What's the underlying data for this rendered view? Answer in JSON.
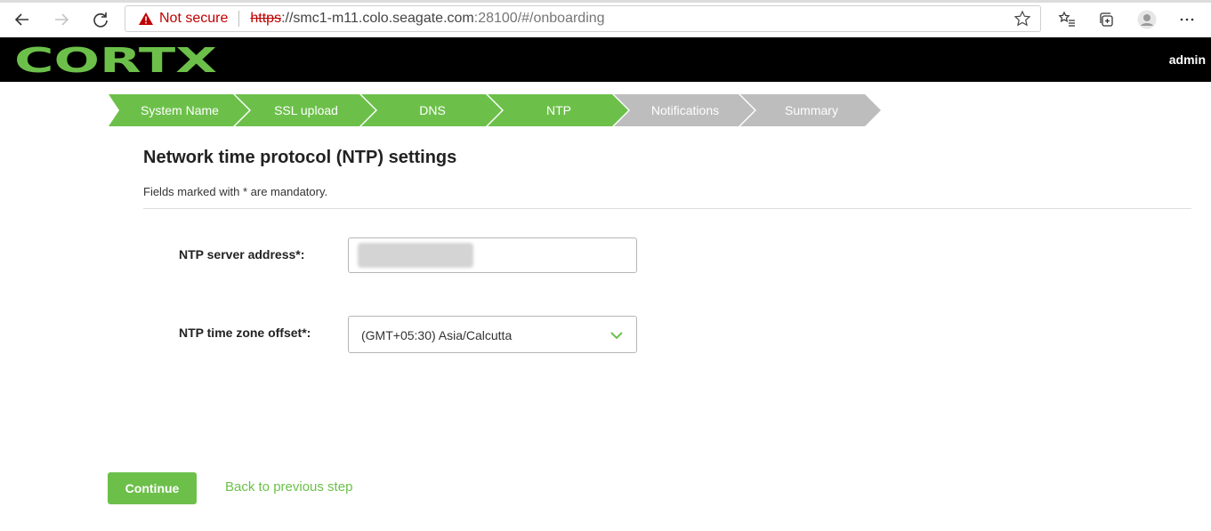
{
  "browser": {
    "security_label": "Not secure",
    "url_scheme": "https",
    "url_host": "://smc1-m11.colo.seagate.com",
    "url_path": ":28100/#/onboarding"
  },
  "header": {
    "logo_text": "CORTX",
    "user": "admin"
  },
  "stepper": {
    "steps": [
      {
        "label": "System Name",
        "state": "complete"
      },
      {
        "label": "SSL upload",
        "state": "complete"
      },
      {
        "label": "DNS",
        "state": "complete"
      },
      {
        "label": "NTP",
        "state": "active"
      },
      {
        "label": "Notifications",
        "state": "pending"
      },
      {
        "label": "Summary",
        "state": "pending"
      }
    ],
    "colors": {
      "complete": "#6cc04a",
      "pending": "#bdbdbd"
    }
  },
  "page": {
    "title": "Network time protocol (NTP) settings",
    "mandatory_note": "Fields marked with * are mandatory."
  },
  "form": {
    "ntp_server_label": "NTP server address*:",
    "ntp_server_value": "",
    "timezone_label": "NTP time zone offset*:",
    "timezone_value": "(GMT+05:30) Asia/Calcutta"
  },
  "actions": {
    "continue_label": "Continue",
    "back_label": "Back to previous step"
  },
  "theme": {
    "accent": "#6cc04a",
    "header_bg": "#000000"
  }
}
